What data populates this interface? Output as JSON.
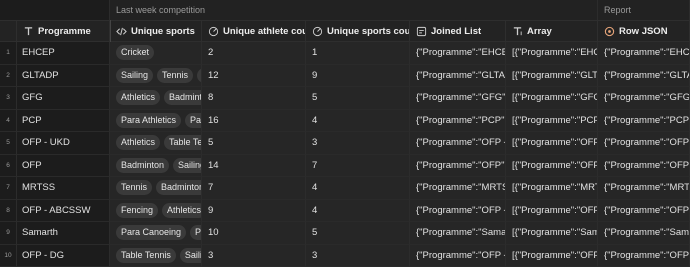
{
  "groups": {
    "last_week": "Last week competition",
    "report": "Report"
  },
  "headers": {
    "programme": "Programme",
    "unique_sports": "Unique sports",
    "unique_athlete_count": "Unique athlete count",
    "unique_sports_count": "Unique sports count",
    "joined_list": "Joined List",
    "array": "Array",
    "row_json": "Row JSON"
  },
  "rows": [
    {
      "num": "1",
      "programme": "EHCEP",
      "sports": [
        "Cricket"
      ],
      "athletes": "2",
      "sports_count": "1",
      "joined": "{\"Programme\":\"EHCEP\"",
      "array": "[{\"Programme\":\"EHCEP\"",
      "row_json": "{\"Programme\":\"EHCEP\""
    },
    {
      "num": "2",
      "programme": "GLTADP",
      "sports": [
        "Sailing",
        "Tennis",
        "Fe"
      ],
      "athletes": "12",
      "sports_count": "9",
      "joined": "{\"Programme\":\"GLTADP\"",
      "array": "[{\"Programme\":\"GLTAD",
      "row_json": "{\"Programme\":\"GLTADP"
    },
    {
      "num": "3",
      "programme": "GFG",
      "sports": [
        "Athletics",
        "Badminton"
      ],
      "athletes": "8",
      "sports_count": "5",
      "joined": "{\"Programme\":\"GFG\",\"",
      "array": "[{\"Programme\":\"GFG\",\"",
      "row_json": "{\"Programme\":\"GFG\",\""
    },
    {
      "num": "4",
      "programme": "PCP",
      "sports": [
        "Para Athletics",
        "Para"
      ],
      "athletes": "16",
      "sports_count": "4",
      "joined": "{\"Programme\":\"PCP\",\"",
      "array": "[{\"Programme\":\"PCP\",\"",
      "row_json": "{\"Programme\":\"PCP\",\""
    },
    {
      "num": "5",
      "programme": "OFP - UKD",
      "sports": [
        "Athletics",
        "Table Ten"
      ],
      "athletes": "5",
      "sports_count": "3",
      "joined": "{\"Programme\":\"OFP - U",
      "array": "[{\"Programme\":\"OFP - U",
      "row_json": "{\"Programme\":\"OFP - U"
    },
    {
      "num": "6",
      "programme": "OFP",
      "sports": [
        "Badminton",
        "Sailing"
      ],
      "athletes": "14",
      "sports_count": "7",
      "joined": "{\"Programme\":\"OFP\",\"A",
      "array": "[{\"Programme\":\"OFP\",\"",
      "row_json": "{\"Programme\":\"OFP\",\""
    },
    {
      "num": "7",
      "programme": "MRTSS",
      "sports": [
        "Tennis",
        "Badminton"
      ],
      "athletes": "7",
      "sports_count": "4",
      "joined": "{\"Programme\":\"MRTSS",
      "array": "[{\"Programme\":\"MRTSS",
      "row_json": "{\"Programme\":\"MRTSS\""
    },
    {
      "num": "8",
      "programme": "OFP - ABCSSW",
      "sports": [
        "Fencing",
        "Athletics"
      ],
      "athletes": "9",
      "sports_count": "4",
      "joined": "{\"Programme\":\"OFP - A",
      "array": "[{\"Programme\":\"OFP - A",
      "row_json": "{\"Programme\":\"OFP - A"
    },
    {
      "num": "9",
      "programme": "Samarth",
      "sports": [
        "Para Canoeing",
        "Para"
      ],
      "athletes": "10",
      "sports_count": "5",
      "joined": "{\"Programme\":\"Samart",
      "array": "[{\"Programme\":\"Samar",
      "row_json": "{\"Programme\":\"Samart"
    },
    {
      "num": "10",
      "programme": "OFP - DG",
      "sports": [
        "Table Tennis",
        "Sailing"
      ],
      "athletes": "3",
      "sports_count": "3",
      "joined": "{\"Programme\":\"OFP - D",
      "array": "[{\"Programme\":\"OFP - D",
      "row_json": "{\"Programme\":\"OFP - D"
    }
  ]
}
